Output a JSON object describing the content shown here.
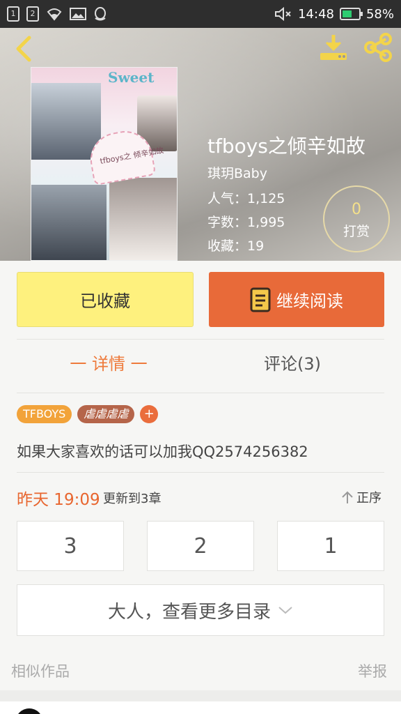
{
  "status_bar": {
    "sim1": "1",
    "sim2": "2",
    "time": "14:48",
    "battery": "58%",
    "battery_level": 0.58,
    "icons": [
      "sim1-icon",
      "sim2-icon",
      "wifi-icon",
      "image-notification-icon",
      "qq-icon",
      "mute-icon",
      "battery-icon"
    ]
  },
  "header": {
    "icons": [
      "back-icon",
      "download-icon",
      "share-icon"
    ]
  },
  "book": {
    "title": "tfboys之倾辛如故",
    "author": "琪玥Baby",
    "popularity": "人气：1,125",
    "word_count": "字数：1,995",
    "favorites": "收藏：19",
    "cover_text": "Sweet",
    "cover_subtitle": "tfboys之 倾辛如故"
  },
  "reward": {
    "count": "0",
    "label": "打赏"
  },
  "actions": {
    "favorite_label": "已收藏",
    "continue_label": "继续阅读"
  },
  "tabs": {
    "detail": "一 详情 一",
    "comments": "评论(3)"
  },
  "tags": [
    "TFBOYS",
    "虐虐虐虐"
  ],
  "intro": "如果大家喜欢的话可以加我QQ2574256382",
  "update": {
    "time": "昨天 19:09",
    "text": "更新到3章",
    "sort_label": "正序"
  },
  "chapters": [
    "3",
    "2",
    "1"
  ],
  "more_catalog": "大人，查看更多目录",
  "footer": {
    "similar": "相似作品",
    "report": "举报"
  },
  "colors": {
    "accent": "#e86a39",
    "favorite_bg": "#fef17e",
    "tab_active": "#ee7a3b",
    "update_time": "#e8662f"
  }
}
